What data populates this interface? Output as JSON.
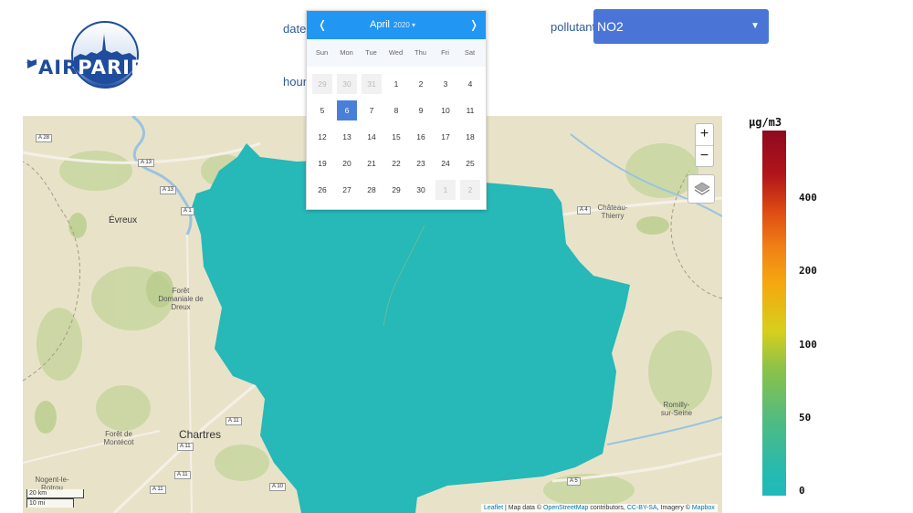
{
  "logo": {
    "left": "AIR",
    "right": "PARIF"
  },
  "form": {
    "date_label": "date",
    "hour_label": "hour",
    "pollutant_label": "pollutant",
    "pollutant_value": "NO2"
  },
  "calendar": {
    "month": "April",
    "year": "2020",
    "prev": "❬",
    "next": "❭",
    "weekdays": [
      "Sun",
      "Mon",
      "Tue",
      "Wed",
      "Thu",
      "Fri",
      "Sat"
    ],
    "selected_day": "6",
    "weeks": [
      [
        {
          "d": "29",
          "m": true
        },
        {
          "d": "30",
          "m": true
        },
        {
          "d": "31",
          "m": true
        },
        {
          "d": "1"
        },
        {
          "d": "2"
        },
        {
          "d": "3"
        },
        {
          "d": "4"
        }
      ],
      [
        {
          "d": "5"
        },
        {
          "d": "6",
          "s": true
        },
        {
          "d": "7"
        },
        {
          "d": "8"
        },
        {
          "d": "9"
        },
        {
          "d": "10"
        },
        {
          "d": "11"
        }
      ],
      [
        {
          "d": "12"
        },
        {
          "d": "13"
        },
        {
          "d": "14"
        },
        {
          "d": "15"
        },
        {
          "d": "16"
        },
        {
          "d": "17"
        },
        {
          "d": "18"
        }
      ],
      [
        {
          "d": "19"
        },
        {
          "d": "20"
        },
        {
          "d": "21"
        },
        {
          "d": "22"
        },
        {
          "d": "23"
        },
        {
          "d": "24"
        },
        {
          "d": "25"
        }
      ],
      [
        {
          "d": "26"
        },
        {
          "d": "27"
        },
        {
          "d": "28"
        },
        {
          "d": "29"
        },
        {
          "d": "30"
        },
        {
          "d": "1",
          "m": true
        },
        {
          "d": "2",
          "m": true
        }
      ]
    ]
  },
  "map": {
    "zoom_in": "+",
    "zoom_out": "−",
    "places": {
      "evreux": "Évreux",
      "foret_dreux": "Forêt Domaniale de Dreux",
      "chartres": "Chartres",
      "foret_montecot": "Forêt de Montécot",
      "nogent": "Nogent-le-Rotrou",
      "chateau_thierry": "Château-Thierry",
      "romilly": "Romilly-sur-Seine"
    },
    "roads": {
      "a28": "A 28",
      "a13a": "A 13",
      "a13b": "A 13",
      "a1": "A 1",
      "a4": "A 4",
      "a11a": "A 11",
      "a11b": "A 11",
      "a11c": "A 11",
      "a11d": "A 11",
      "a10": "A 10",
      "a5": "A 5"
    },
    "scale_km": "20 km",
    "scale_mi": "10 mi",
    "attribution": {
      "leaflet": "Leaflet",
      "t1": " | Map data © ",
      "osm": "OpenStreetMap",
      "t2": " contributors, ",
      "cc": "CC-BY-SA",
      "t3": ", Imagery © ",
      "mapbox": "Mapbox"
    },
    "pollution_color": "#27b8b8"
  },
  "legend": {
    "unit": "µg/m3",
    "ticks": [
      "400",
      "200",
      "100",
      "50",
      "0"
    ]
  }
}
